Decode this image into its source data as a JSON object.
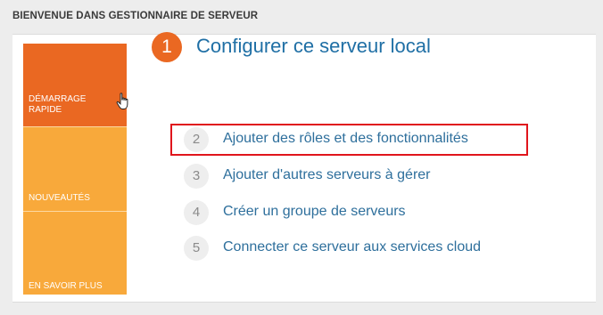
{
  "header": {
    "title": "BIENVENUE DANS GESTIONNAIRE DE SERVEUR"
  },
  "sidebar": {
    "tiles": [
      {
        "label": "DÉMARRAGE RAPIDE"
      },
      {
        "label": "NOUVEAUTÉS"
      },
      {
        "label": "EN SAVOIR PLUS"
      }
    ]
  },
  "main": {
    "step_number": "1",
    "heading": "Configurer ce serveur local",
    "tasks": [
      {
        "number": "2",
        "label": "Ajouter des rôles et des fonctionnalités"
      },
      {
        "number": "3",
        "label": "Ajouter d'autres serveurs à gérer"
      },
      {
        "number": "4",
        "label": "Créer un groupe de serveurs"
      },
      {
        "number": "5",
        "label": "Connecter ce serveur aux services cloud"
      }
    ]
  },
  "colors": {
    "accent_orange": "#ea6822",
    "tile_yellow": "#f8a93b",
    "link_blue": "#2e6f9c",
    "highlight_red": "#e0151c"
  },
  "icons": {
    "cursor": "hand-pointer-icon"
  }
}
